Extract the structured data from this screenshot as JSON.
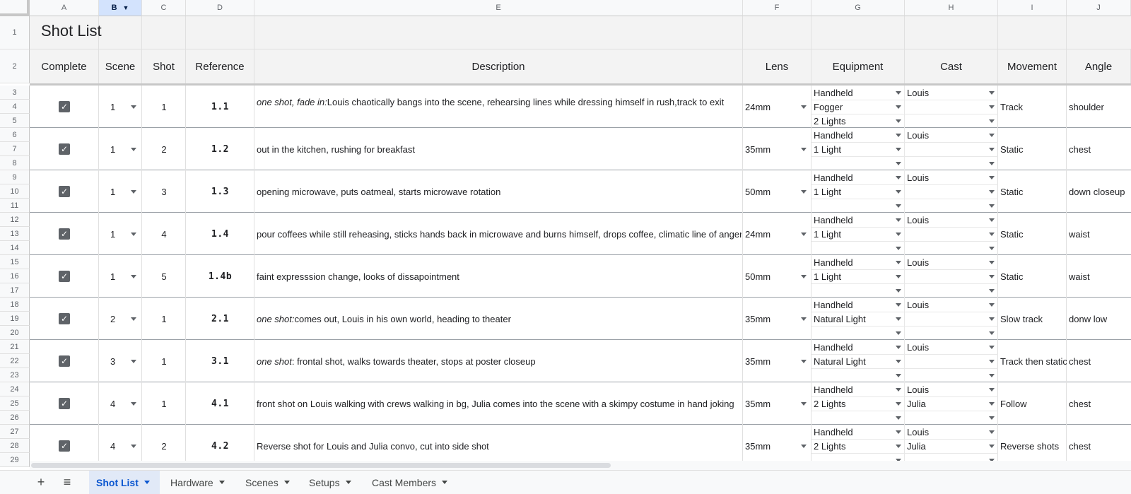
{
  "columns": [
    "A",
    "B",
    "C",
    "D",
    "E",
    "F",
    "G",
    "H",
    "I",
    "J"
  ],
  "rows": [
    "1",
    "2",
    "3",
    "4",
    "5",
    "6",
    "7",
    "8",
    "9",
    "10",
    "11",
    "12",
    "13",
    "14",
    "15",
    "16",
    "17",
    "18",
    "19",
    "20",
    "21",
    "22",
    "23",
    "24",
    "25",
    "26",
    "27",
    "28",
    "29"
  ],
  "title": "Shot List",
  "headers": {
    "complete": "Complete",
    "scene": "Scene",
    "shot": "Shot",
    "reference": "Reference",
    "description": "Description",
    "lens": "Lens",
    "equipment": "Equipment",
    "cast": "Cast",
    "movement": "Movement",
    "angle": "Angle"
  },
  "shots": [
    {
      "scene": "1",
      "shot": "1",
      "ref": "1.1",
      "desc_em": "one shot, fade in:",
      "desc": " Louis chaotically bangs into the scene, rehearsing lines while dressing himself in rush,track to exit",
      "lens": "24mm",
      "equipment": [
        "Handheld",
        "Fogger",
        "2 Lights"
      ],
      "cast": [
        "Louis",
        "",
        ""
      ],
      "movement": "Track",
      "angle": "shoulder"
    },
    {
      "scene": "1",
      "shot": "2",
      "ref": "1.2",
      "desc_em": "",
      "desc": "out in the kitchen, rushing for breakfast",
      "lens": "35mm",
      "equipment": [
        "Handheld",
        "1 Light",
        ""
      ],
      "cast": [
        "Louis",
        "",
        ""
      ],
      "movement": "Static",
      "angle": "chest"
    },
    {
      "scene": "1",
      "shot": "3",
      "ref": "1.3",
      "desc_em": "",
      "desc": "opening microwave, puts oatmeal, starts microwave rotation",
      "lens": "50mm",
      "equipment": [
        "Handheld",
        "1 Light",
        ""
      ],
      "cast": [
        "Louis",
        "",
        ""
      ],
      "movement": "Static",
      "angle": "down closeup"
    },
    {
      "scene": "1",
      "shot": "4",
      "ref": "1.4",
      "desc_em": "",
      "desc": "pour coffees while still reheasing, sticks hands back in microwave and burns himself, drops coffee, climatic line of anger",
      "lens": "24mm",
      "equipment": [
        "Handheld",
        "1 Light",
        ""
      ],
      "cast": [
        "Louis",
        "",
        ""
      ],
      "movement": "Static",
      "angle": "waist"
    },
    {
      "scene": "1",
      "shot": "5",
      "ref": "1.4b",
      "desc_em": "",
      "desc": "faint expresssion change, looks of dissapointment",
      "lens": "50mm",
      "equipment": [
        "Handheld",
        "1 Light",
        ""
      ],
      "cast": [
        "Louis",
        "",
        ""
      ],
      "movement": "Static",
      "angle": "waist"
    },
    {
      "scene": "2",
      "shot": "1",
      "ref": "2.1",
      "desc_em": "one shot:",
      "desc": " comes out, Louis in his own world, heading to theater",
      "lens": "35mm",
      "equipment": [
        "Handheld",
        "Natural Light",
        ""
      ],
      "cast": [
        "Louis",
        "",
        ""
      ],
      "movement": "Slow track",
      "angle": "donw low"
    },
    {
      "scene": "3",
      "shot": "1",
      "ref": "3.1",
      "desc_em": "one shot",
      "desc": ": frontal shot, walks towards theater, stops at poster closeup",
      "lens": "35mm",
      "equipment": [
        "Handheld",
        "Natural Light",
        ""
      ],
      "cast": [
        "Louis",
        "",
        ""
      ],
      "movement": "Track then static",
      "angle": "chest"
    },
    {
      "scene": "4",
      "shot": "1",
      "ref": "4.1",
      "desc_em": "",
      "desc": "front shot on Louis walking with crews walking in bg, Julia comes into the scene with a skimpy costume in hand joking",
      "lens": "35mm",
      "equipment": [
        "Handheld",
        "2 Lights",
        ""
      ],
      "cast": [
        "Louis",
        "Julia",
        ""
      ],
      "movement": " Follow",
      "angle": "chest"
    },
    {
      "scene": "4",
      "shot": "2",
      "ref": "4.2",
      "desc_em": "",
      "desc": "Reverse shot for Louis and Julia convo, cut into side shot",
      "lens": "35mm",
      "equipment": [
        "Handheld",
        "2 Lights",
        ""
      ],
      "cast": [
        "Louis",
        "Julia",
        ""
      ],
      "movement": "Reverse shots",
      "angle": "chest"
    }
  ],
  "tabs": [
    "Shot List",
    "Hardware",
    "Scenes",
    "Setups",
    "Cast Members"
  ],
  "active_tab": "Shot List",
  "icons": {
    "add_sheet": "+",
    "all_sheets": "≡",
    "check": "✓"
  },
  "colors": {
    "selected_col": "#d3e3fd",
    "active_tab_text": "#0b57d0",
    "checkbox": "#5f6368"
  }
}
